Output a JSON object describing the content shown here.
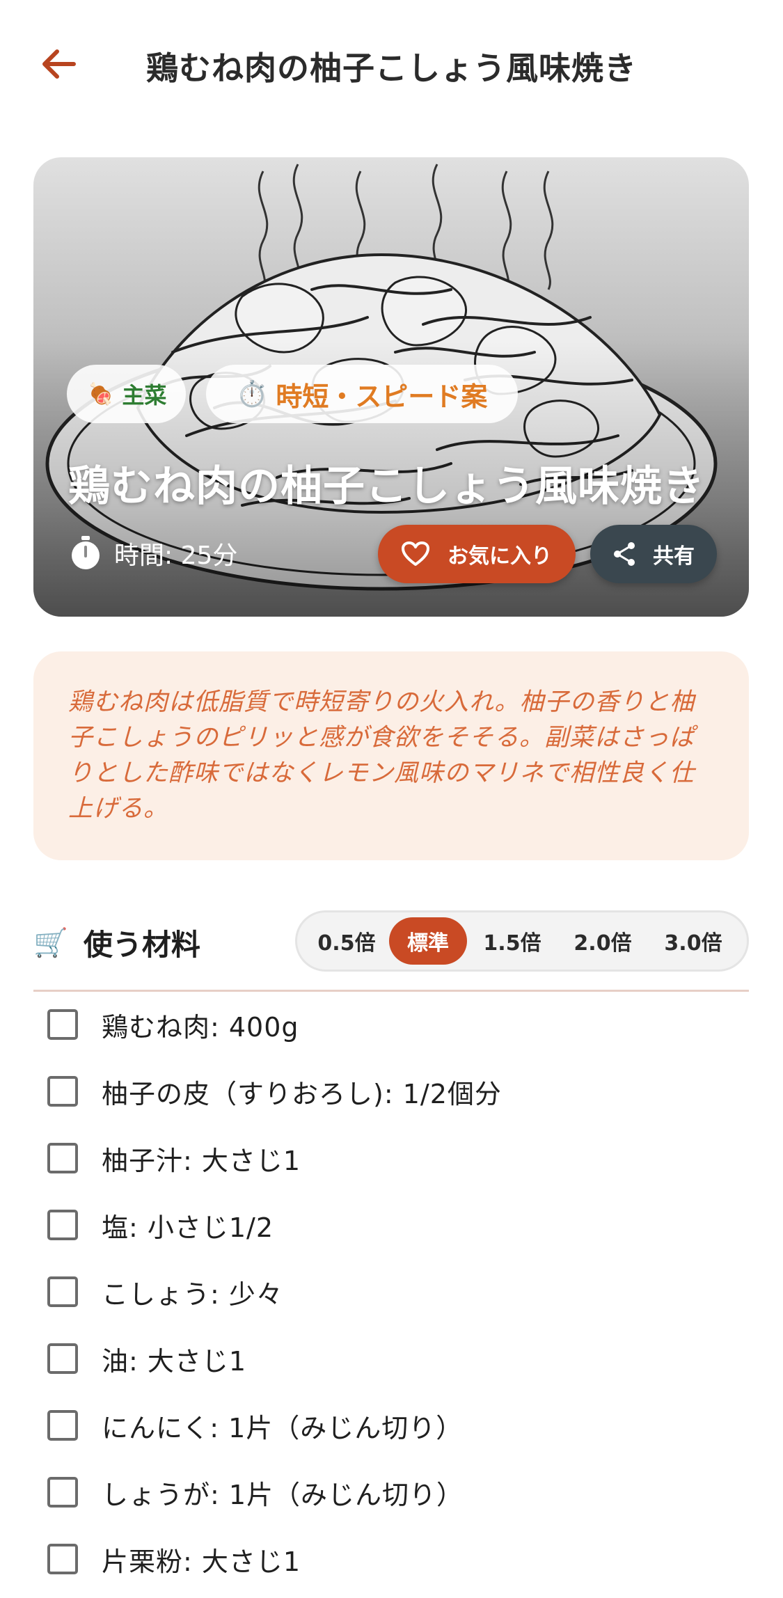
{
  "header": {
    "title": "鶏むね肉の柚子こしょう風味焼き"
  },
  "hero": {
    "category_chip": "主菜",
    "speed_chip": "時短・スピード案",
    "title": "鶏むね肉の柚子こしょう風味焼き",
    "time_label": "時間: 25分",
    "favorite_label": "お気に入り",
    "share_label": "共有"
  },
  "description": "鶏むね肉は低脂質で時短寄りの火入れ。柚子の香りと柚子こしょうのピリッと感が食欲をそそる。副菜はさっぱりとした酢味ではなくレモン風味のマリネで相性良く仕上げる。",
  "ingredients": {
    "title": "使う材料",
    "scales": [
      "0.5倍",
      "標準",
      "1.5倍",
      "2.0倍",
      "3.0倍"
    ],
    "active_scale": "標準",
    "items": [
      "鶏むね肉: 400g",
      "柚子の皮（すりおろし): 1/2個分",
      "柚子汁: 大さじ1",
      "塩: 小さじ1/2",
      "こしょう: 少々",
      "油: 大さじ1",
      "にんにく: 1片（みじん切り）",
      "しょうが: 1片（みじん切り）",
      "片栗粉: 大さじ1"
    ]
  },
  "colors": {
    "accent": "#c94a24",
    "share": "#3a474f",
    "category_green": "#2e7d32",
    "speed_orange": "#e07b22",
    "description_bg": "#fcefe6",
    "description_text": "#d86a3a"
  },
  "icons": {
    "back": "arrow-left-icon",
    "category": "meat-icon",
    "speed": "stopwatch-icon",
    "time": "timer-icon",
    "favorite": "heart-icon",
    "share": "share-icon",
    "ingredients": "cart-icon"
  }
}
